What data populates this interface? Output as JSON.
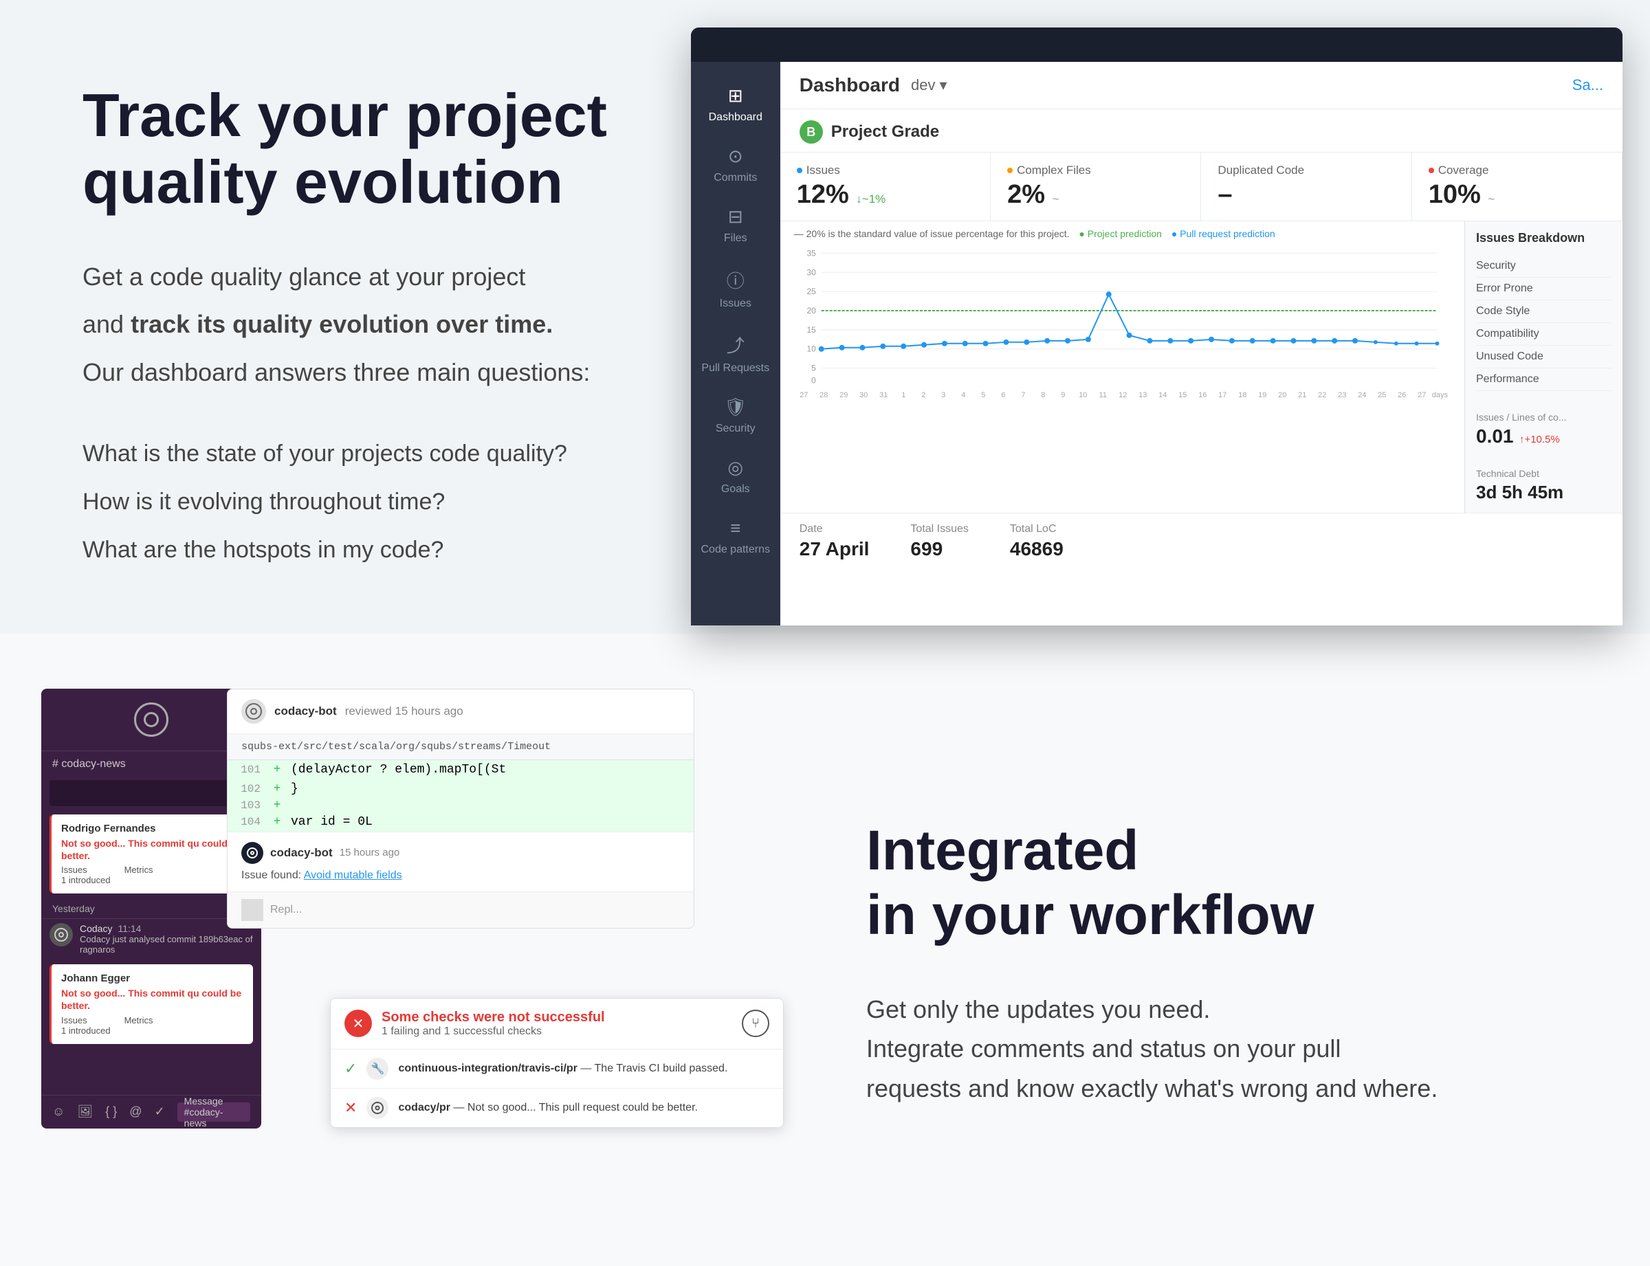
{
  "top": {
    "heading_line1": "Track your project",
    "heading_line2": "quality evolution",
    "intro_line1": "Get a code quality glance at your project",
    "intro_line2_before": "and ",
    "intro_line2_bold": "track its quality evolution over time.",
    "intro_line3": "Our dashboard answers three main questions:",
    "questions": [
      "What is the state of your projects code quality?",
      "How is it evolving throughout time?",
      "What are the hotspots in my code?"
    ]
  },
  "dashboard": {
    "title": "Dashboard",
    "branch": "dev",
    "save_link": "Sa...",
    "grade_letter": "B",
    "project_grade_label": "Project Grade",
    "metrics": [
      {
        "label": "Issues",
        "dot_color": "blue",
        "value": "12%",
        "change": "↓~1%",
        "change_type": "positive"
      },
      {
        "label": "Complex Files",
        "dot_color": "orange",
        "value": "2%",
        "change": "~",
        "change_type": "neutral"
      },
      {
        "label": "Duplicated Code",
        "dot_color": "none",
        "value": "–",
        "change": "",
        "change_type": "neutral"
      },
      {
        "label": "Coverage",
        "dot_color": "red",
        "value": "10%",
        "change": "~",
        "change_type": "neutral"
      }
    ],
    "chart_legend": "— 20% is the standard value of issue percentage for this project.",
    "chart_legend2": "● Project prediction",
    "chart_legend3": "● Pull request prediction",
    "chart_y_labels": [
      "35",
      "30",
      "25",
      "20",
      "15",
      "10",
      "5",
      "0"
    ],
    "chart_x_labels": [
      "27",
      "28",
      "29",
      "30",
      "31",
      "1",
      "2",
      "3",
      "4",
      "5",
      "6",
      "7",
      "8",
      "9",
      "10",
      "11",
      "12",
      "13",
      "14",
      "15",
      "16",
      "17",
      "18",
      "19",
      "20",
      "21",
      "22",
      "23",
      "24",
      "25",
      "26",
      "27",
      "days"
    ],
    "date_label": "Date",
    "date_value": "27 April",
    "total_issues_label": "Total Issues",
    "total_issues_value": "699",
    "total_loc_label": "Total LoC",
    "total_loc_value": "46869",
    "breakdown_title": "Issues Breakdown",
    "breakdown_items": [
      "Security",
      "Error Prone",
      "Code Style",
      "Compatibility",
      "Unused Code",
      "Performance"
    ],
    "issues_loc_label": "Issues / Lines of co...",
    "issues_loc_value": "0.01",
    "issues_loc_change": "↑+10.5%",
    "tech_debt_label": "Technical Debt",
    "tech_debt_value": "3d 5h 45m"
  },
  "sidebar": {
    "items": [
      {
        "label": "Dashboard",
        "icon": "⊞"
      },
      {
        "label": "Commits",
        "icon": "⊙"
      },
      {
        "label": "Files",
        "icon": "⊟"
      },
      {
        "label": "Issues",
        "icon": "ⓘ"
      },
      {
        "label": "Pull Requests",
        "icon": "⤴"
      },
      {
        "label": "Security",
        "icon": "🛡"
      },
      {
        "label": "Goals",
        "icon": "◎"
      },
      {
        "label": "Code patterns",
        "icon": "≡"
      }
    ]
  },
  "bottom": {
    "heading_line1": "Integrated",
    "heading_line2": "in your workflow",
    "desc_line1": "Get only the updates you need.",
    "desc_line2": "Integrate comments and status on your pull",
    "desc_line3": "requests and know exactly what's wrong and where."
  },
  "pr_review": {
    "bot_name": "codacy-bot",
    "reviewed_text": "reviewed 15 hours ago",
    "file_path": "squbs-ext/src/test/scala/org/squbs/streams/Timeout",
    "code_lines": [
      {
        "num": "101",
        "sym": "+",
        "content": "(delayActor ? elem).mapTo[(St",
        "added": true
      },
      {
        "num": "102",
        "sym": "+",
        "content": "}",
        "added": true
      },
      {
        "num": "103",
        "sym": "+",
        "content": "",
        "added": true
      },
      {
        "num": "104",
        "sym": "+",
        "content": "var id = 0L",
        "added": true
      }
    ],
    "comment_bot": "codacy-bot",
    "comment_time": "15 hours ago",
    "issue_text": "Issue found:",
    "issue_link": "Avoid mutable fields",
    "reply_text": "Repl..."
  },
  "github_checks": {
    "title": "Some checks were not successful",
    "subtitle": "1 failing and 1 successful checks",
    "checks": [
      {
        "status": "pass",
        "service": "travis",
        "name": "continuous-integration/travis-ci/pr",
        "desc": "— The Travis CI build passed."
      },
      {
        "status": "fail",
        "service": "codacy",
        "name": "codacy/pr",
        "desc": "— Not so good... This pull request could be better."
      }
    ]
  },
  "slack": {
    "channel_label": "# codacy-news",
    "commits": [
      {
        "user": "Rodrigo Fernandes",
        "status": "Not so good... This commit qu could be better.",
        "issues_label": "Issues",
        "issues_val": "1 introduced",
        "metrics_label": "Metrics"
      }
    ],
    "yesterday_label": "Yesterday",
    "notifications": [
      {
        "app": "Codacy",
        "time": "11:14",
        "text": "Codacy just analysed commit 189b63eac of ragnaros"
      }
    ],
    "commits2": [
      {
        "user": "Johann Egger",
        "status": "Not so good... This commit qu could be better.",
        "issues_label": "Issues",
        "issues_val": "1 introduced",
        "metrics_label": "Metrics"
      }
    ]
  }
}
